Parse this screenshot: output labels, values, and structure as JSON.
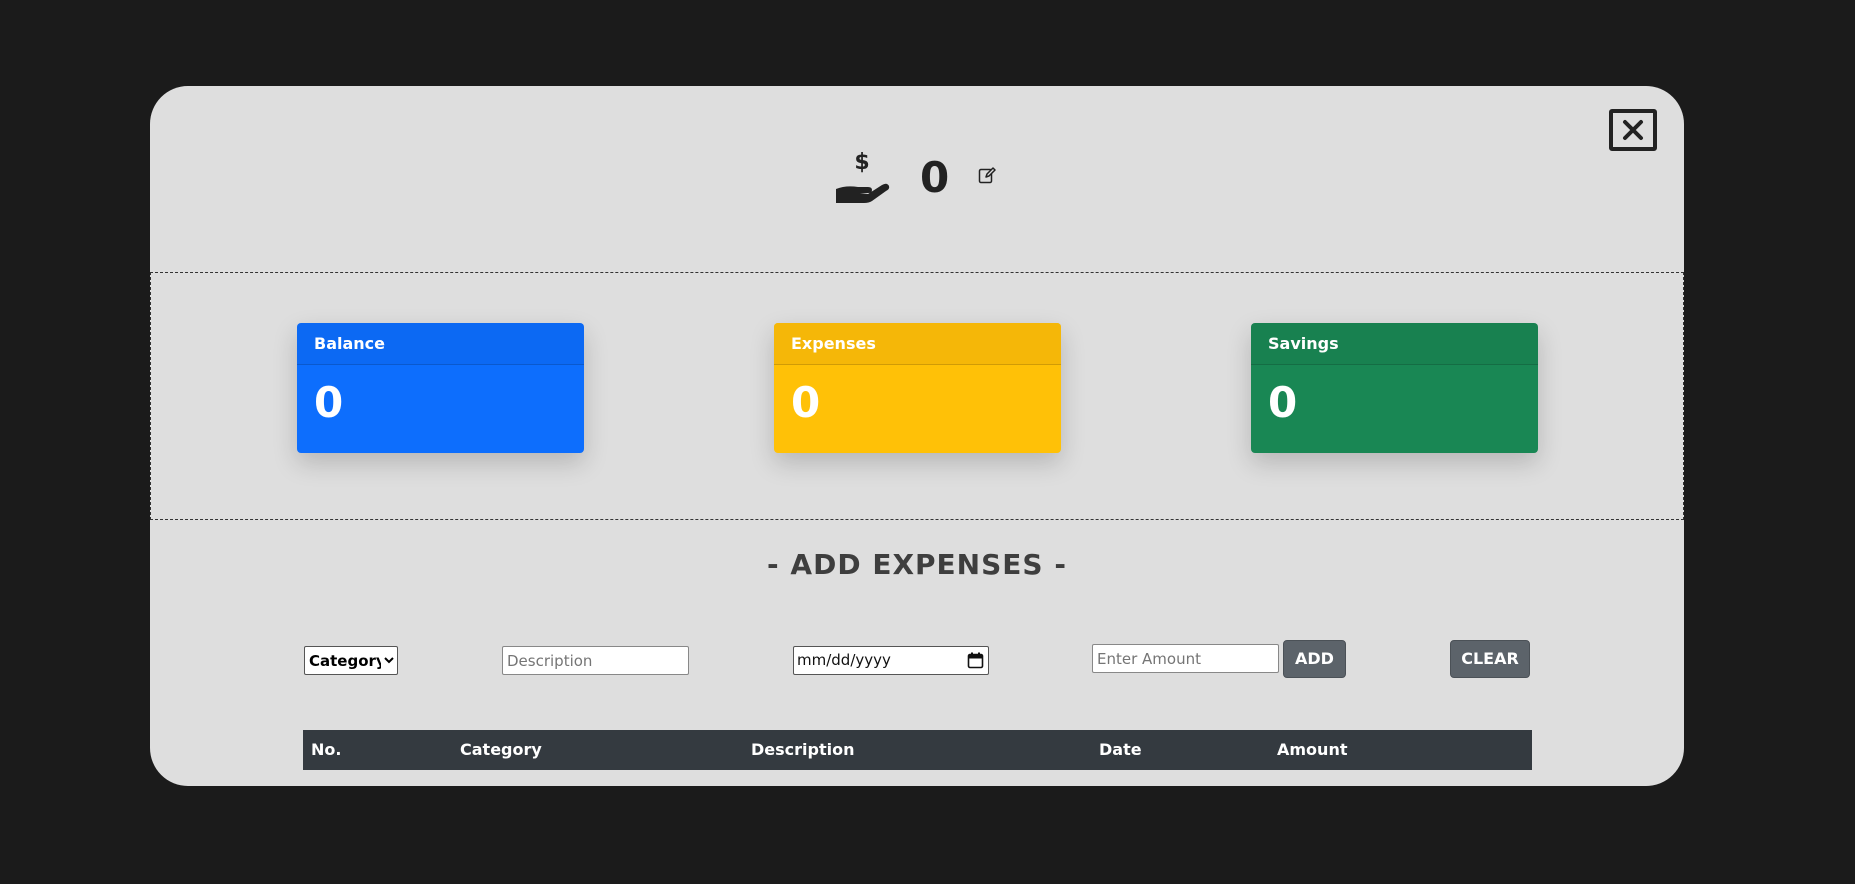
{
  "header": {
    "income_value": "0"
  },
  "cards": {
    "balance": {
      "label": "Balance",
      "value": "0"
    },
    "expenses": {
      "label": "Expenses",
      "value": "0"
    },
    "savings": {
      "label": "Savings",
      "value": "0"
    }
  },
  "section": {
    "title": "- ADD EXPENSES -"
  },
  "form": {
    "category_selected": "Category",
    "description_placeholder": "Description",
    "date_value": "mm/dd/yyyy",
    "amount_placeholder": "Enter Amount",
    "add_label": "ADD",
    "clear_label": "CLEAR"
  },
  "table": {
    "columns": [
      "No.",
      "Category",
      "Description",
      "Date",
      "Amount"
    ]
  },
  "colors": {
    "balance": "#0d6efd",
    "expenses": "#ffc107",
    "savings": "#198754",
    "button": "#5c636a",
    "table_header": "#343a40"
  },
  "icons": {
    "close": "close-icon",
    "income": "hand-dollar-icon",
    "edit": "edit-icon",
    "calendar": "calendar-icon"
  }
}
